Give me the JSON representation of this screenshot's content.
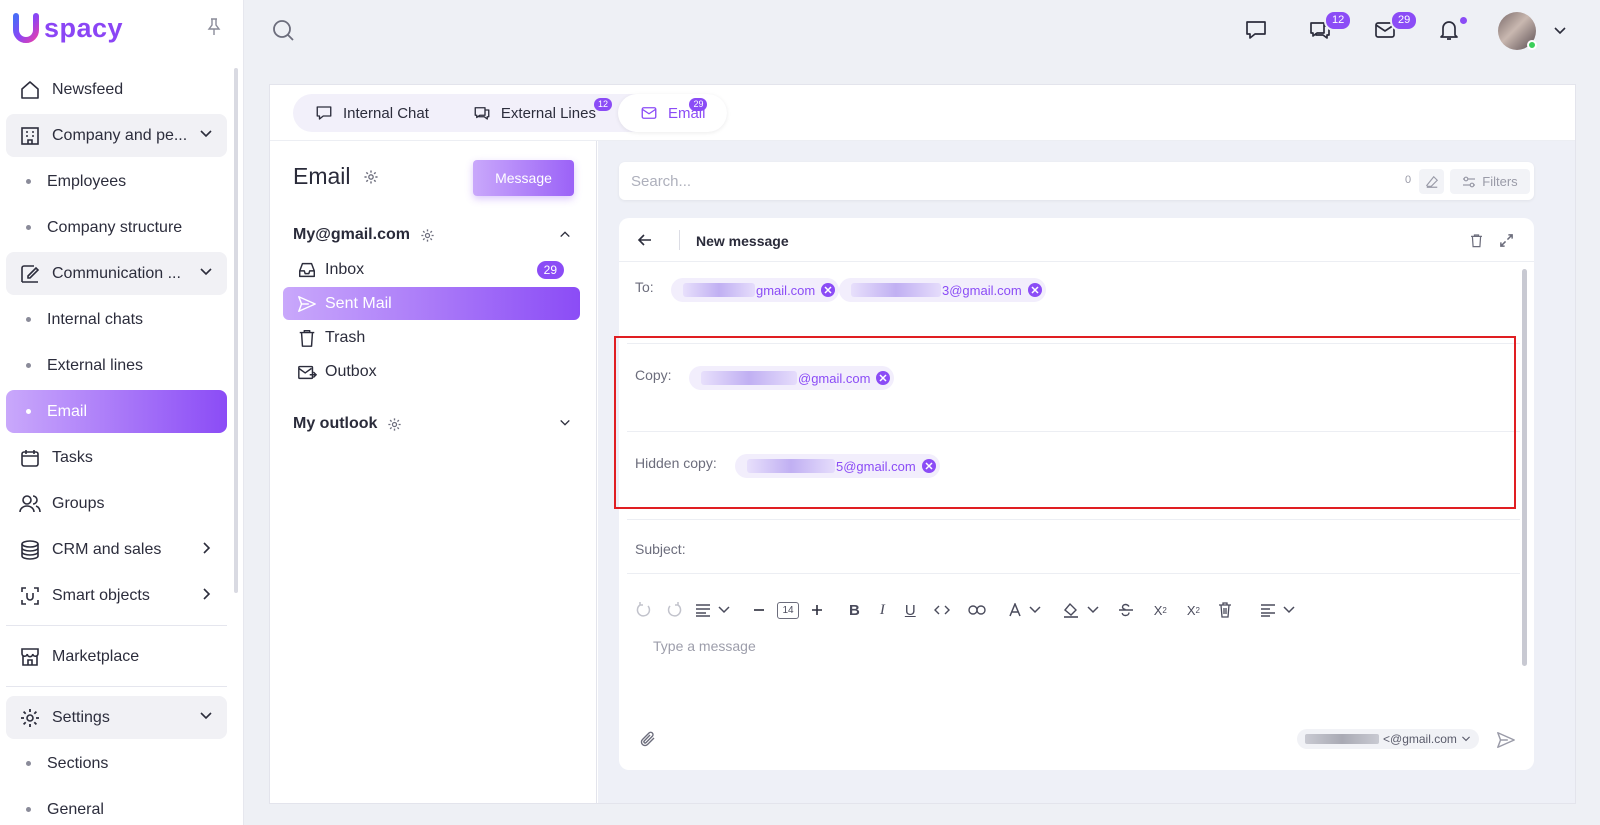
{
  "app": {
    "logo_text": "spacy"
  },
  "sidebar": {
    "items": [
      {
        "label": "Newsfeed"
      },
      {
        "label": "Company and pe..."
      },
      {
        "label": "Employees"
      },
      {
        "label": "Company structure"
      },
      {
        "label": "Communication ..."
      },
      {
        "label": "Internal chats"
      },
      {
        "label": "External lines"
      },
      {
        "label": "Email"
      },
      {
        "label": "Tasks"
      },
      {
        "label": "Groups"
      },
      {
        "label": "CRM and sales"
      },
      {
        "label": "Smart objects"
      },
      {
        "label": "Marketplace"
      },
      {
        "label": "Settings"
      },
      {
        "label": "Sections"
      },
      {
        "label": "General"
      }
    ]
  },
  "topbar": {
    "chats_badge": "12",
    "mail_badge": "29"
  },
  "tabs": [
    {
      "label": "Internal Chat",
      "badge": ""
    },
    {
      "label": "External Lines",
      "badge": "12"
    },
    {
      "label": "Email",
      "badge": "29"
    }
  ],
  "email": {
    "title": "Email",
    "message_button": "Message",
    "account1": "My@gmail.com",
    "account2": "My outlook",
    "folders": [
      {
        "label": "Inbox",
        "count": "29"
      },
      {
        "label": "Sent Mail",
        "count": ""
      },
      {
        "label": "Trash",
        "count": ""
      },
      {
        "label": "Outbox",
        "count": ""
      }
    ]
  },
  "search": {
    "placeholder": "Search...",
    "count": "0",
    "filters": "Filters"
  },
  "compose": {
    "title": "New message",
    "to_label": "To:",
    "to_chips": [
      "gmail.com",
      "3@gmail.com"
    ],
    "copy_label": "Copy:",
    "copy_chips": [
      "@gmail.com"
    ],
    "hidden_label": "Hidden copy:",
    "hidden_chips": [
      "5@gmail.com"
    ],
    "subject_label": "Subject:",
    "font_size": "14",
    "body_placeholder": "Type a message",
    "from": "<@gmail.com"
  },
  "colors": {
    "accent": "#8b4cf6",
    "highlight": "#e01e22"
  }
}
